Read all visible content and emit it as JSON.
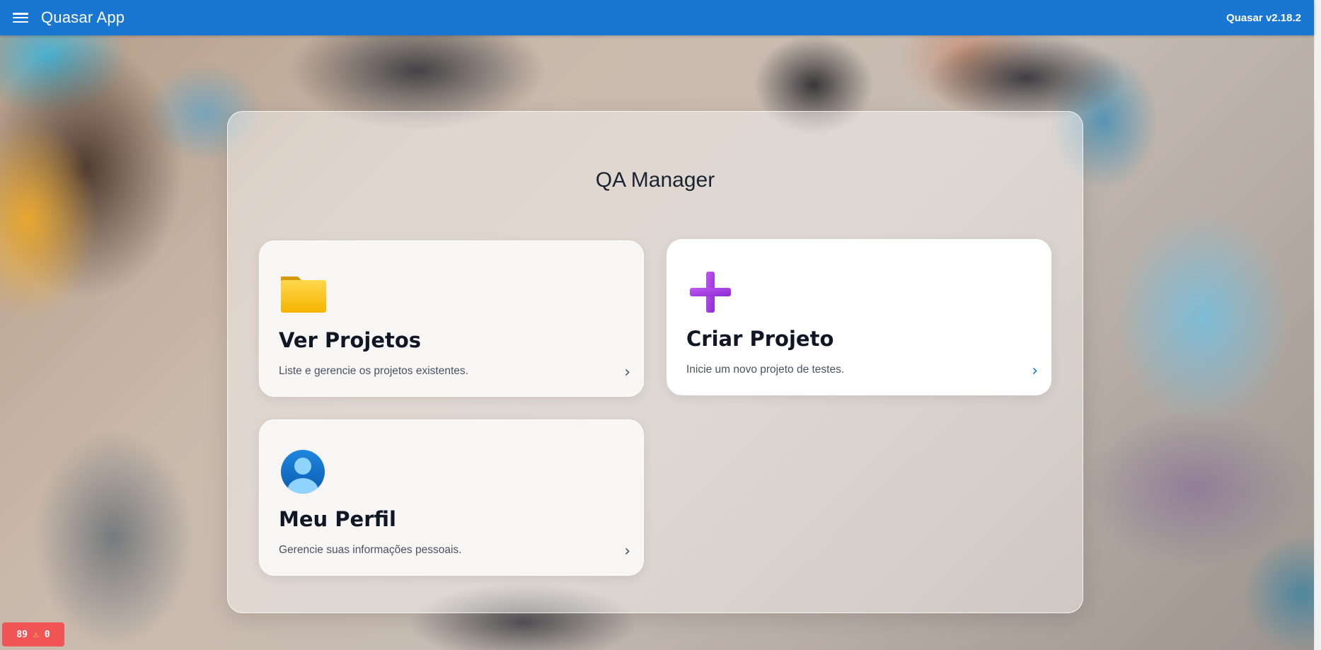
{
  "header": {
    "app_title": "Quasar App",
    "version": "Quasar v2.18.2",
    "color": "#1976d2"
  },
  "main": {
    "title": "QA Manager",
    "cards": [
      {
        "icon": "folder-icon",
        "title": "Ver Projetos",
        "description": "Liste e gerencie os projetos existentes."
      },
      {
        "icon": "plus-icon",
        "title": "Criar Projeto",
        "description": "Inicie um novo projeto de testes."
      },
      {
        "icon": "user-avatar-icon",
        "title": "Meu Perfil",
        "description": "Gerencie suas informações pessoais."
      }
    ]
  },
  "dev_badge": {
    "errors": "89",
    "warnings": "0"
  }
}
